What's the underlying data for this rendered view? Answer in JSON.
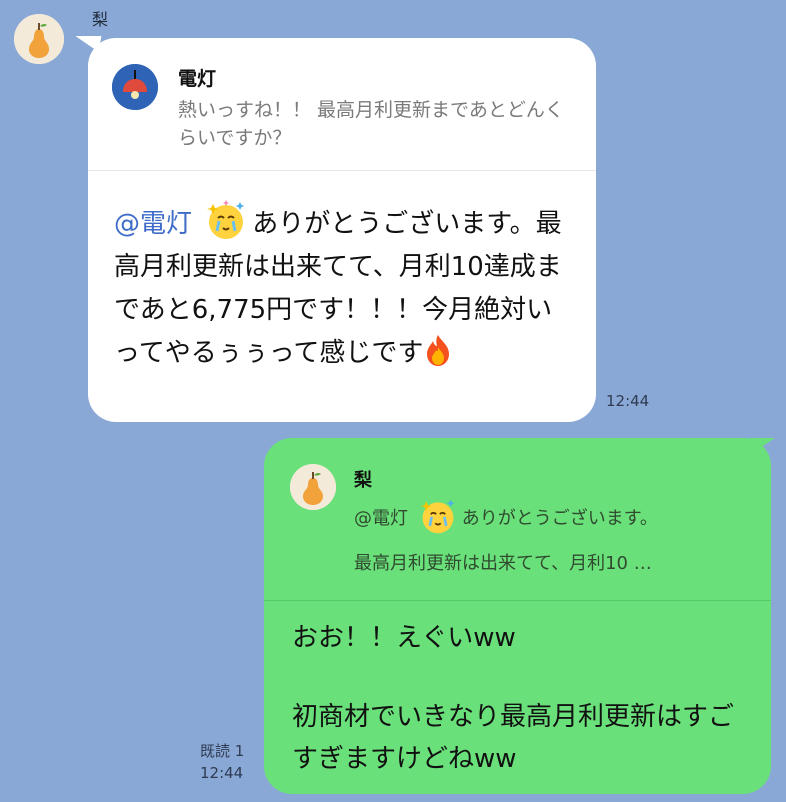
{
  "chat": {
    "sender": {
      "name": "梨",
      "avatar_icon": "pear-icon"
    },
    "incoming": {
      "reply_to": {
        "name": "電灯",
        "avatar_icon": "lamp-icon",
        "text": "熱いっすね！！ 最高月利更新まであとどんくらいですか？"
      },
      "mention": "@電灯",
      "emoji_1": "crying-face-emoji",
      "body": "ありがとうございます。最高月利更新は出来てて、月利10達成まであと6,775円です！！！今月絶対いってやるぅぅって感じです",
      "emoji_2": "fire-emoji",
      "time": "12:44"
    },
    "outgoing": {
      "reply_to": {
        "name": "梨",
        "avatar_icon": "pear-icon",
        "line1_prefix": "@電灯",
        "line1_suffix": "ありがとうございます。",
        "line2": "最高月利更新は出来てて、月利10 …"
      },
      "line1": "おお！！えぐいww",
      "line2": "初商材でいきなり最高月利更新はすごすぎますけどねww",
      "read_status": "既読 1",
      "time": "12:44"
    }
  },
  "colors": {
    "background": "#8aa8d6",
    "incoming_bubble": "#ffffff",
    "outgoing_bubble": "#6ae07a",
    "mention": "#3e6cc8"
  }
}
